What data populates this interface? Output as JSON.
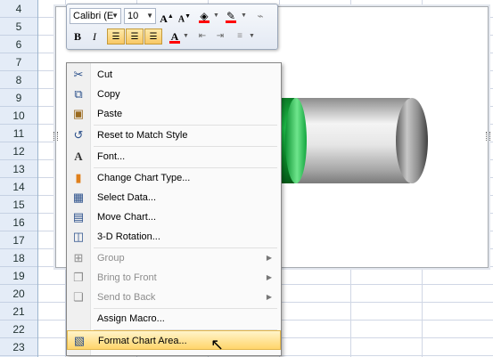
{
  "row_headers": [
    "4",
    "5",
    "6",
    "7",
    "8",
    "9",
    "10",
    "11",
    "12",
    "13",
    "14",
    "15",
    "16",
    "17",
    "18",
    "19",
    "20",
    "21",
    "22",
    "23"
  ],
  "mini_toolbar": {
    "font_name": "Calibri (E",
    "font_size": "10",
    "grow_font": "A",
    "shrink_font": "A",
    "bold": "B",
    "italic": "I",
    "font_color_letter": "A"
  },
  "context_menu": {
    "cut": "Cut",
    "copy": "Copy",
    "paste": "Paste",
    "reset_to_match_style": "Reset to Match Style",
    "font": "Font...",
    "change_chart_type": "Change Chart Type...",
    "select_data": "Select Data...",
    "move_chart": "Move Chart...",
    "rotation_3d": "3-D Rotation...",
    "group": "Group",
    "bring_to_front": "Bring to Front",
    "send_to_back": "Send to Back",
    "assign_macro": "Assign Macro...",
    "format_chart_area": "Format Chart Area..."
  },
  "colors": {
    "highlight_color": "#ff0000",
    "font_color": "#ff0000",
    "menu_highlight": "#ffd56b",
    "series_green": "#1ec04a"
  },
  "icons": {
    "cut": "scissors-icon",
    "copy": "copy-icon",
    "paste": "clipboard-icon",
    "reset": "reset-style-icon",
    "font": "font-icon",
    "change_chart_type": "bar-chart-icon",
    "select_data": "table-icon",
    "move_chart": "move-chart-icon",
    "rotation": "cube-icon",
    "group": "group-icon",
    "bring_to_front": "bring-front-icon",
    "send_to_back": "send-back-icon",
    "format_chart_area": "format-icon"
  }
}
